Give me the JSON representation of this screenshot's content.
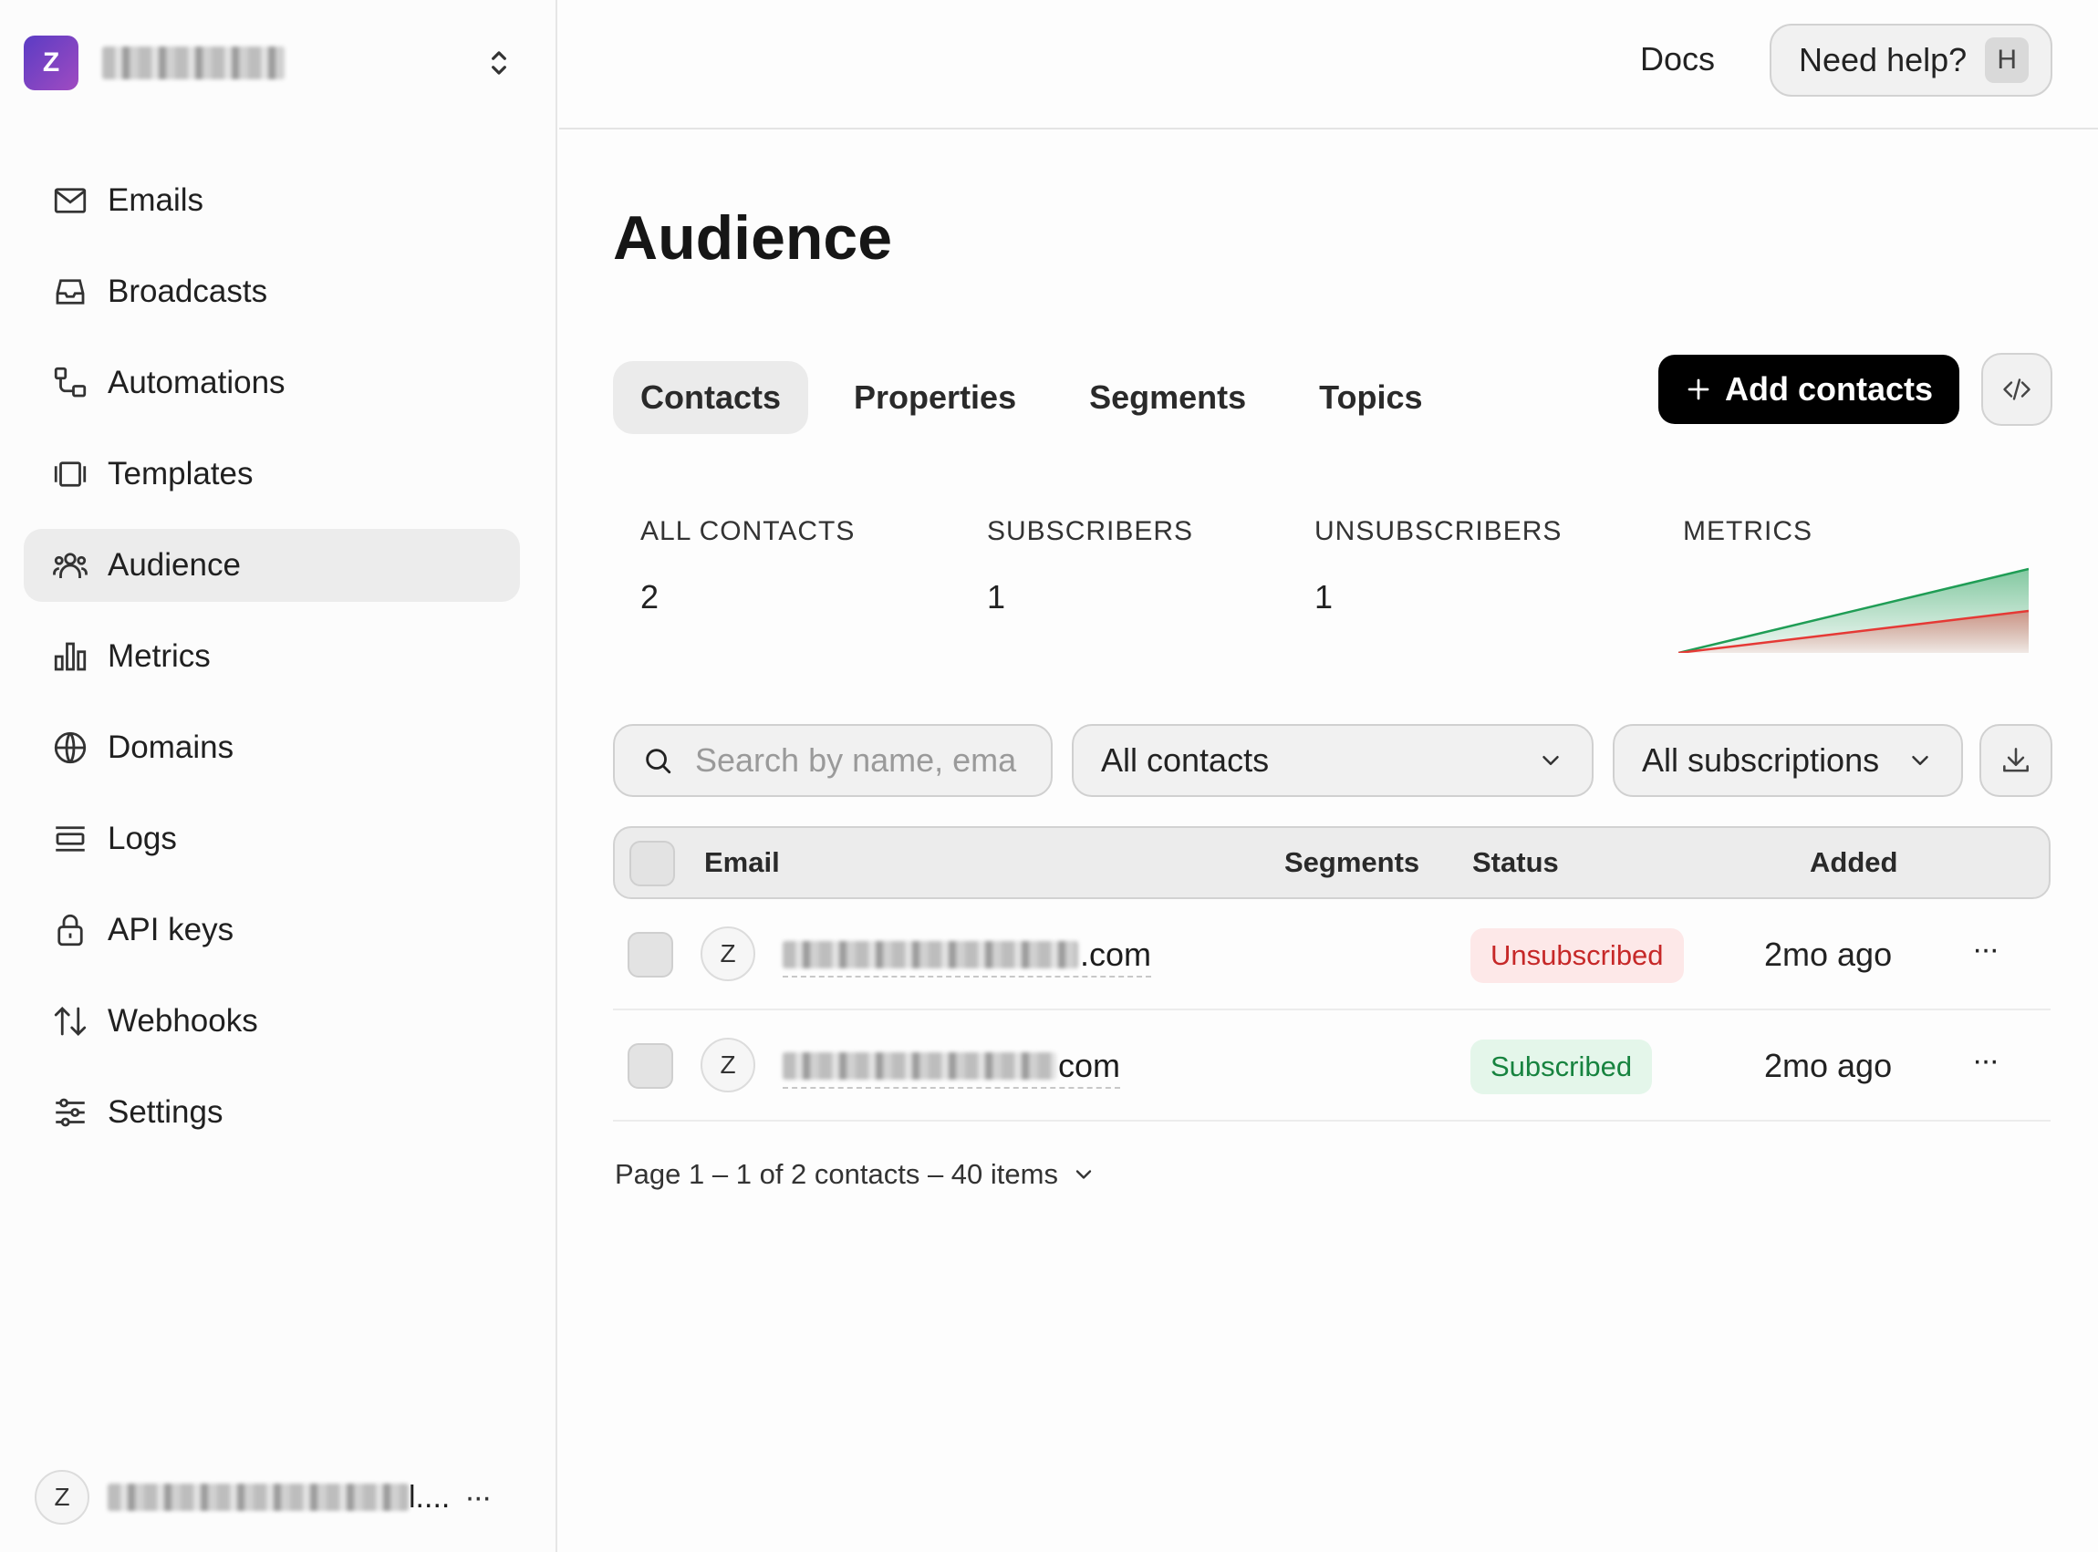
{
  "sidebar": {
    "workspace": {
      "initial": "Z",
      "name_redacted": true
    },
    "items": [
      {
        "label": "Emails",
        "icon": "mail-icon",
        "active": false
      },
      {
        "label": "Broadcasts",
        "icon": "inbox-icon",
        "active": false
      },
      {
        "label": "Automations",
        "icon": "workflow-icon",
        "active": false
      },
      {
        "label": "Templates",
        "icon": "template-icon",
        "active": false
      },
      {
        "label": "Audience",
        "icon": "users-icon",
        "active": true
      },
      {
        "label": "Metrics",
        "icon": "bar-chart-icon",
        "active": false
      },
      {
        "label": "Domains",
        "icon": "globe-icon",
        "active": false
      },
      {
        "label": "Logs",
        "icon": "logs-icon",
        "active": false
      },
      {
        "label": "API keys",
        "icon": "lock-icon",
        "active": false
      },
      {
        "label": "Webhooks",
        "icon": "arrows-updown-icon",
        "active": false
      },
      {
        "label": "Settings",
        "icon": "sliders-icon",
        "active": false
      }
    ],
    "user": {
      "initial": "Z",
      "name_suffix": "l....",
      "more": "···"
    }
  },
  "header": {
    "docs_label": "Docs",
    "help_label": "Need help?",
    "help_shortcut": "H"
  },
  "page": {
    "title": "Audience",
    "tabs": [
      {
        "label": "Contacts",
        "active": true
      },
      {
        "label": "Properties",
        "active": false
      },
      {
        "label": "Segments",
        "active": false
      },
      {
        "label": "Topics",
        "active": false
      }
    ],
    "add_contacts_label": "Add contacts"
  },
  "stats": {
    "all_contacts": {
      "label": "ALL CONTACTS",
      "value": "2"
    },
    "subscribers": {
      "label": "SUBSCRIBERS",
      "value": "1"
    },
    "unsubscribers": {
      "label": "UNSUBSCRIBERS",
      "value": "1"
    },
    "metrics": {
      "label": "METRICS"
    }
  },
  "chart_data": {
    "type": "area",
    "x": [
      0,
      1
    ],
    "series": [
      {
        "values": [
          0,
          2
        ],
        "color": "#1f9d55"
      },
      {
        "values": [
          0,
          1
        ],
        "color": "#e53935"
      }
    ],
    "ylim": [
      0,
      2
    ],
    "grid": false
  },
  "filters": {
    "search_placeholder": "Search by name, ema",
    "contacts_filter": "All contacts",
    "subscriptions_filter": "All subscriptions"
  },
  "table": {
    "columns": {
      "email": "Email",
      "segments": "Segments",
      "status": "Status",
      "added": "Added"
    },
    "rows": [
      {
        "initial": "Z",
        "email_suffix": ".com",
        "status": "Unsubscribed",
        "status_type": "unsub",
        "added": "2mo ago",
        "more": "···"
      },
      {
        "initial": "Z",
        "email_suffix": "com",
        "status": "Subscribed",
        "status_type": "sub",
        "added": "2mo ago",
        "more": "···"
      }
    ]
  },
  "pagination": {
    "text": "Page 1 – 1 of 2 contacts – 40 items"
  }
}
